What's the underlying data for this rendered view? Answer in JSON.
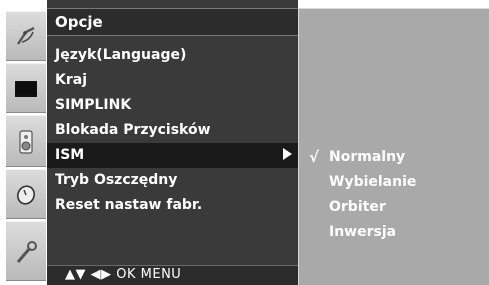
{
  "menu": {
    "title": "Opcje",
    "items": [
      {
        "label": "Język(Language)"
      },
      {
        "label": "Kraj"
      },
      {
        "label": "SIMPLINK"
      },
      {
        "label": "Blokada Przycisków"
      },
      {
        "label": "ISM",
        "selected": true
      },
      {
        "label": "Tryb Oszczędny"
      },
      {
        "label": "Reset nastaw fabr."
      }
    ]
  },
  "nav_hint": "▲▼ ◀▶ OK MENU",
  "submenu": {
    "check_mark": "√",
    "items": [
      {
        "label": "Normalny",
        "checked": true
      },
      {
        "label": "Wybielanie"
      },
      {
        "label": "Orbiter"
      },
      {
        "label": "Inwersja"
      }
    ]
  },
  "icons": [
    "satellite-dish-icon",
    "screen-icon",
    "speaker-icon",
    "clock-icon",
    "wrench-icon"
  ],
  "colors": {
    "menu_bg": "#3a3a3a",
    "selected_bg": "#1a1a1a",
    "submenu_bg": "#a9a9a9",
    "text": "#ffffff"
  }
}
